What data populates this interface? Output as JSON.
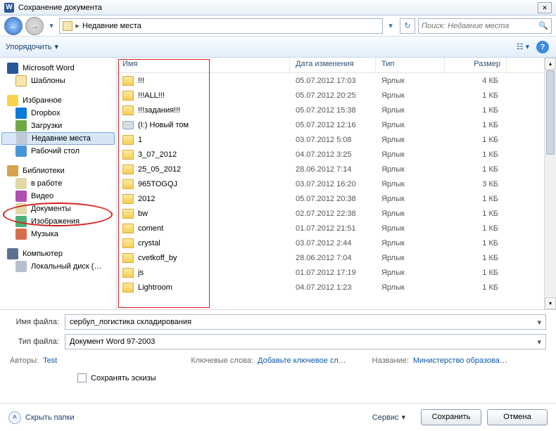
{
  "title": "Сохранение документа",
  "breadcrumb": {
    "item": "Недавние места"
  },
  "search": {
    "placeholder": "Поиск: Недавние места"
  },
  "toolbar": {
    "organize": "Упорядочить"
  },
  "sidebar": {
    "word": "Microsoft Word",
    "templates": "Шаблоны",
    "fav": "Избранное",
    "dropbox": "Dropbox",
    "downloads": "Загрузки",
    "recent": "Недавние места",
    "desktop": "Рабочий стол",
    "libs": "Библиотеки",
    "inwork": "в работе",
    "video": "Видео",
    "docs": "Документы",
    "images": "Изображения",
    "music": "Музыка",
    "computer": "Компьютер",
    "localdisk": "Локальный диск (…"
  },
  "columns": {
    "name": "Имя",
    "date": "Дата изменения",
    "type": "Тип",
    "size": "Размер"
  },
  "files": [
    {
      "name": "!!!",
      "date": "05.07.2012 17:03",
      "type": "Ярлык",
      "size": "4 КБ",
      "icon": "folder"
    },
    {
      "name": "!!!ALL!!!",
      "date": "05.07.2012 20:25",
      "type": "Ярлык",
      "size": "1 КБ",
      "icon": "folder"
    },
    {
      "name": "!!!задания!!!",
      "date": "05.07.2012 15:38",
      "type": "Ярлык",
      "size": "1 КБ",
      "icon": "folder"
    },
    {
      "name": "(I:) Новый том",
      "date": "05.07.2012 12:16",
      "type": "Ярлык",
      "size": "1 КБ",
      "icon": "drive"
    },
    {
      "name": "1",
      "date": "03.07.2012 5:08",
      "type": "Ярлык",
      "size": "1 КБ",
      "icon": "folder"
    },
    {
      "name": "3_07_2012",
      "date": "04.07.2012 3:25",
      "type": "Ярлык",
      "size": "1 КБ",
      "icon": "folder"
    },
    {
      "name": "25_05_2012",
      "date": "28.06.2012 7:14",
      "type": "Ярлык",
      "size": "1 КБ",
      "icon": "folder"
    },
    {
      "name": "965TOGQJ",
      "date": "03.07.2012 16:20",
      "type": "Ярлык",
      "size": "3 КБ",
      "icon": "folder"
    },
    {
      "name": "2012",
      "date": "05.07.2012 20:38",
      "type": "Ярлык",
      "size": "1 КБ",
      "icon": "folder"
    },
    {
      "name": "bw",
      "date": "02.07.2012 22:38",
      "type": "Ярлык",
      "size": "1 КБ",
      "icon": "folder"
    },
    {
      "name": "coment",
      "date": "01.07.2012 21:51",
      "type": "Ярлык",
      "size": "1 КБ",
      "icon": "folder"
    },
    {
      "name": "crystal",
      "date": "03.07.2012 2:44",
      "type": "Ярлык",
      "size": "1 КБ",
      "icon": "folder"
    },
    {
      "name": "cvetkoff_by",
      "date": "28.06.2012 7:04",
      "type": "Ярлык",
      "size": "1 КБ",
      "icon": "folder"
    },
    {
      "name": "js",
      "date": "01.07.2012 17:19",
      "type": "Ярлык",
      "size": "1 КБ",
      "icon": "folder"
    },
    {
      "name": "Lightroom",
      "date": "04.07.2012 1:23",
      "type": "Ярлык",
      "size": "1 КБ",
      "icon": "folder"
    }
  ],
  "form": {
    "name_label": "Имя файла:",
    "name_value": "сербул_логистика складирования",
    "type_label": "Тип файла:",
    "type_value": "Документ Word 97-2003"
  },
  "meta": {
    "authors_k": "Авторы:",
    "authors_v": "Test",
    "keywords_k": "Ключевые слова:",
    "keywords_v": "Добавьте ключевое сл…",
    "title_k": "Название:",
    "title_v": "Министерство образова…"
  },
  "thumbs": "Сохранять эскизы",
  "footer": {
    "hide": "Скрыть папки",
    "service": "Сервис",
    "save": "Сохранить",
    "cancel": "Отмена"
  }
}
